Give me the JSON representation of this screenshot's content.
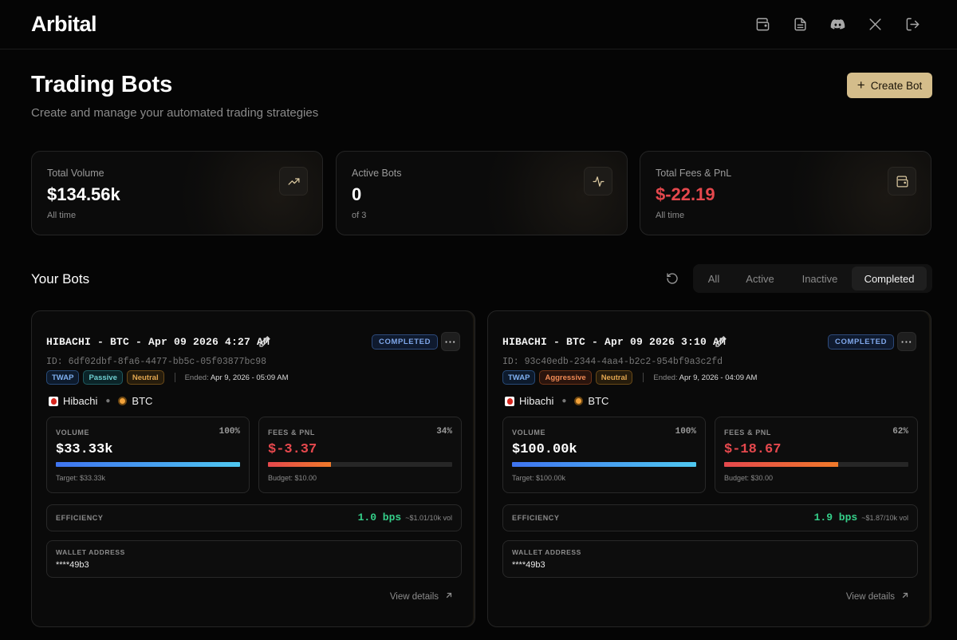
{
  "app": {
    "logo": "Arbital"
  },
  "nav_icons": [
    "wallet-icon",
    "document-icon",
    "discord-icon",
    "x-icon",
    "logout-icon"
  ],
  "header": {
    "title": "Trading Bots",
    "subtitle": "Create and manage your automated trading strategies",
    "create_label": "Create Bot"
  },
  "stats": [
    {
      "label": "Total Volume",
      "value": "$134.56k",
      "sub": "All time",
      "icon": "trending-up-icon"
    },
    {
      "label": "Active Bots",
      "value": "0",
      "sub": "of 3",
      "icon": "activity-icon"
    },
    {
      "label": "Total Fees & PnL",
      "value": "$-22.19",
      "sub": "All time",
      "icon": "wallet-icon",
      "value_color": "#e5484d"
    }
  ],
  "bots_section": {
    "title": "Your Bots",
    "filters": [
      "All",
      "Active",
      "Inactive",
      "Completed"
    ],
    "active_filter": "Completed"
  },
  "bots": [
    {
      "title": "HIBACHI - BTC - Apr 09 2026 4:27 AM",
      "status": "COMPLETED",
      "id": "ID: 6df02dbf-8fa6-4477-bb5c-05f03877bc98",
      "tags": [
        "TWAP",
        "Passive",
        "Neutral"
      ],
      "ended_label": "Ended:",
      "ended_value": "Apr 9, 2026 - 05:09 AM",
      "exchange": "Hibachi",
      "asset": "BTC",
      "volume": {
        "label": "VOLUME",
        "pct": "100%",
        "value": "$33.33k",
        "fill": 1.0,
        "foot": "Target: $33.33k"
      },
      "fees": {
        "label": "FEES & PNL",
        "pct": "34%",
        "value": "$-3.37",
        "fill": 0.34,
        "foot": "Budget: $10.00"
      },
      "efficiency": {
        "label": "EFFICIENCY",
        "value": "1.0 bps",
        "sub": "~$1.01/10k vol"
      },
      "wallet": {
        "label": "WALLET ADDRESS",
        "value": "****49b3"
      },
      "view_details": "View details"
    },
    {
      "title": "HIBACHI - BTC - Apr 09 2026 3:10 AM",
      "status": "COMPLETED",
      "id": "ID: 93c40edb-2344-4aa4-b2c2-954bf9a3c2fd",
      "tags": [
        "TWAP",
        "Aggressive",
        "Neutral"
      ],
      "ended_label": "Ended:",
      "ended_value": "Apr 9, 2026 - 04:09 AM",
      "exchange": "Hibachi",
      "asset": "BTC",
      "volume": {
        "label": "VOLUME",
        "pct": "100%",
        "value": "$100.00k",
        "fill": 1.0,
        "foot": "Target: $100.00k"
      },
      "fees": {
        "label": "FEES & PNL",
        "pct": "62%",
        "value": "$-18.67",
        "fill": 0.62,
        "foot": "Budget: $30.00"
      },
      "efficiency": {
        "label": "EFFICIENCY",
        "value": "1.9 bps",
        "sub": "~$1.87/10k vol"
      },
      "wallet": {
        "label": "WALLET ADDRESS",
        "value": "****49b3"
      },
      "view_details": "View details"
    }
  ]
}
